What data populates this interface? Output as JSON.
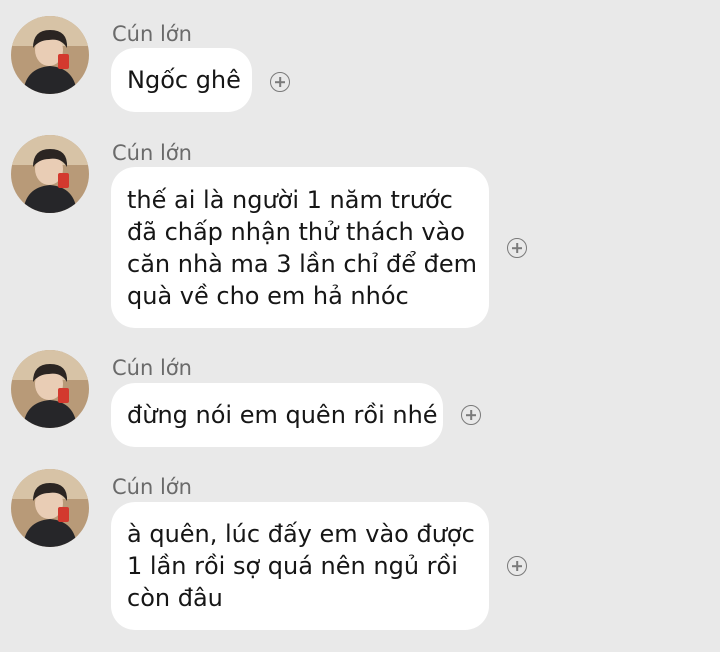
{
  "messages": [
    {
      "sender": "Cún lớn",
      "lines": [
        "Ngốc ghê"
      ]
    },
    {
      "sender": "Cún lớn",
      "lines": [
        "thế ai là người 1 năm trước",
        "đã chấp nhận thử thách vào",
        "căn nhà ma 3 lần chỉ để đem",
        "quà về cho em hả nhóc"
      ]
    },
    {
      "sender": "Cún lớn",
      "lines": [
        "đừng nói em quên rồi nhé"
      ]
    },
    {
      "sender": "Cún lớn",
      "lines": [
        "à quên, lúc đấy em vào được",
        "1 lần rồi sợ quá nên ngủ rồi",
        "còn đâu"
      ]
    }
  ],
  "icons": {
    "reaction": "add-reaction-icon",
    "avatar": "user-avatar"
  },
  "colors": {
    "background": "#e9e9e9",
    "bubble": "#ffffff",
    "sender_name": "#6a6a6a",
    "message_text": "#161616",
    "icon": "#7a7a7a"
  }
}
